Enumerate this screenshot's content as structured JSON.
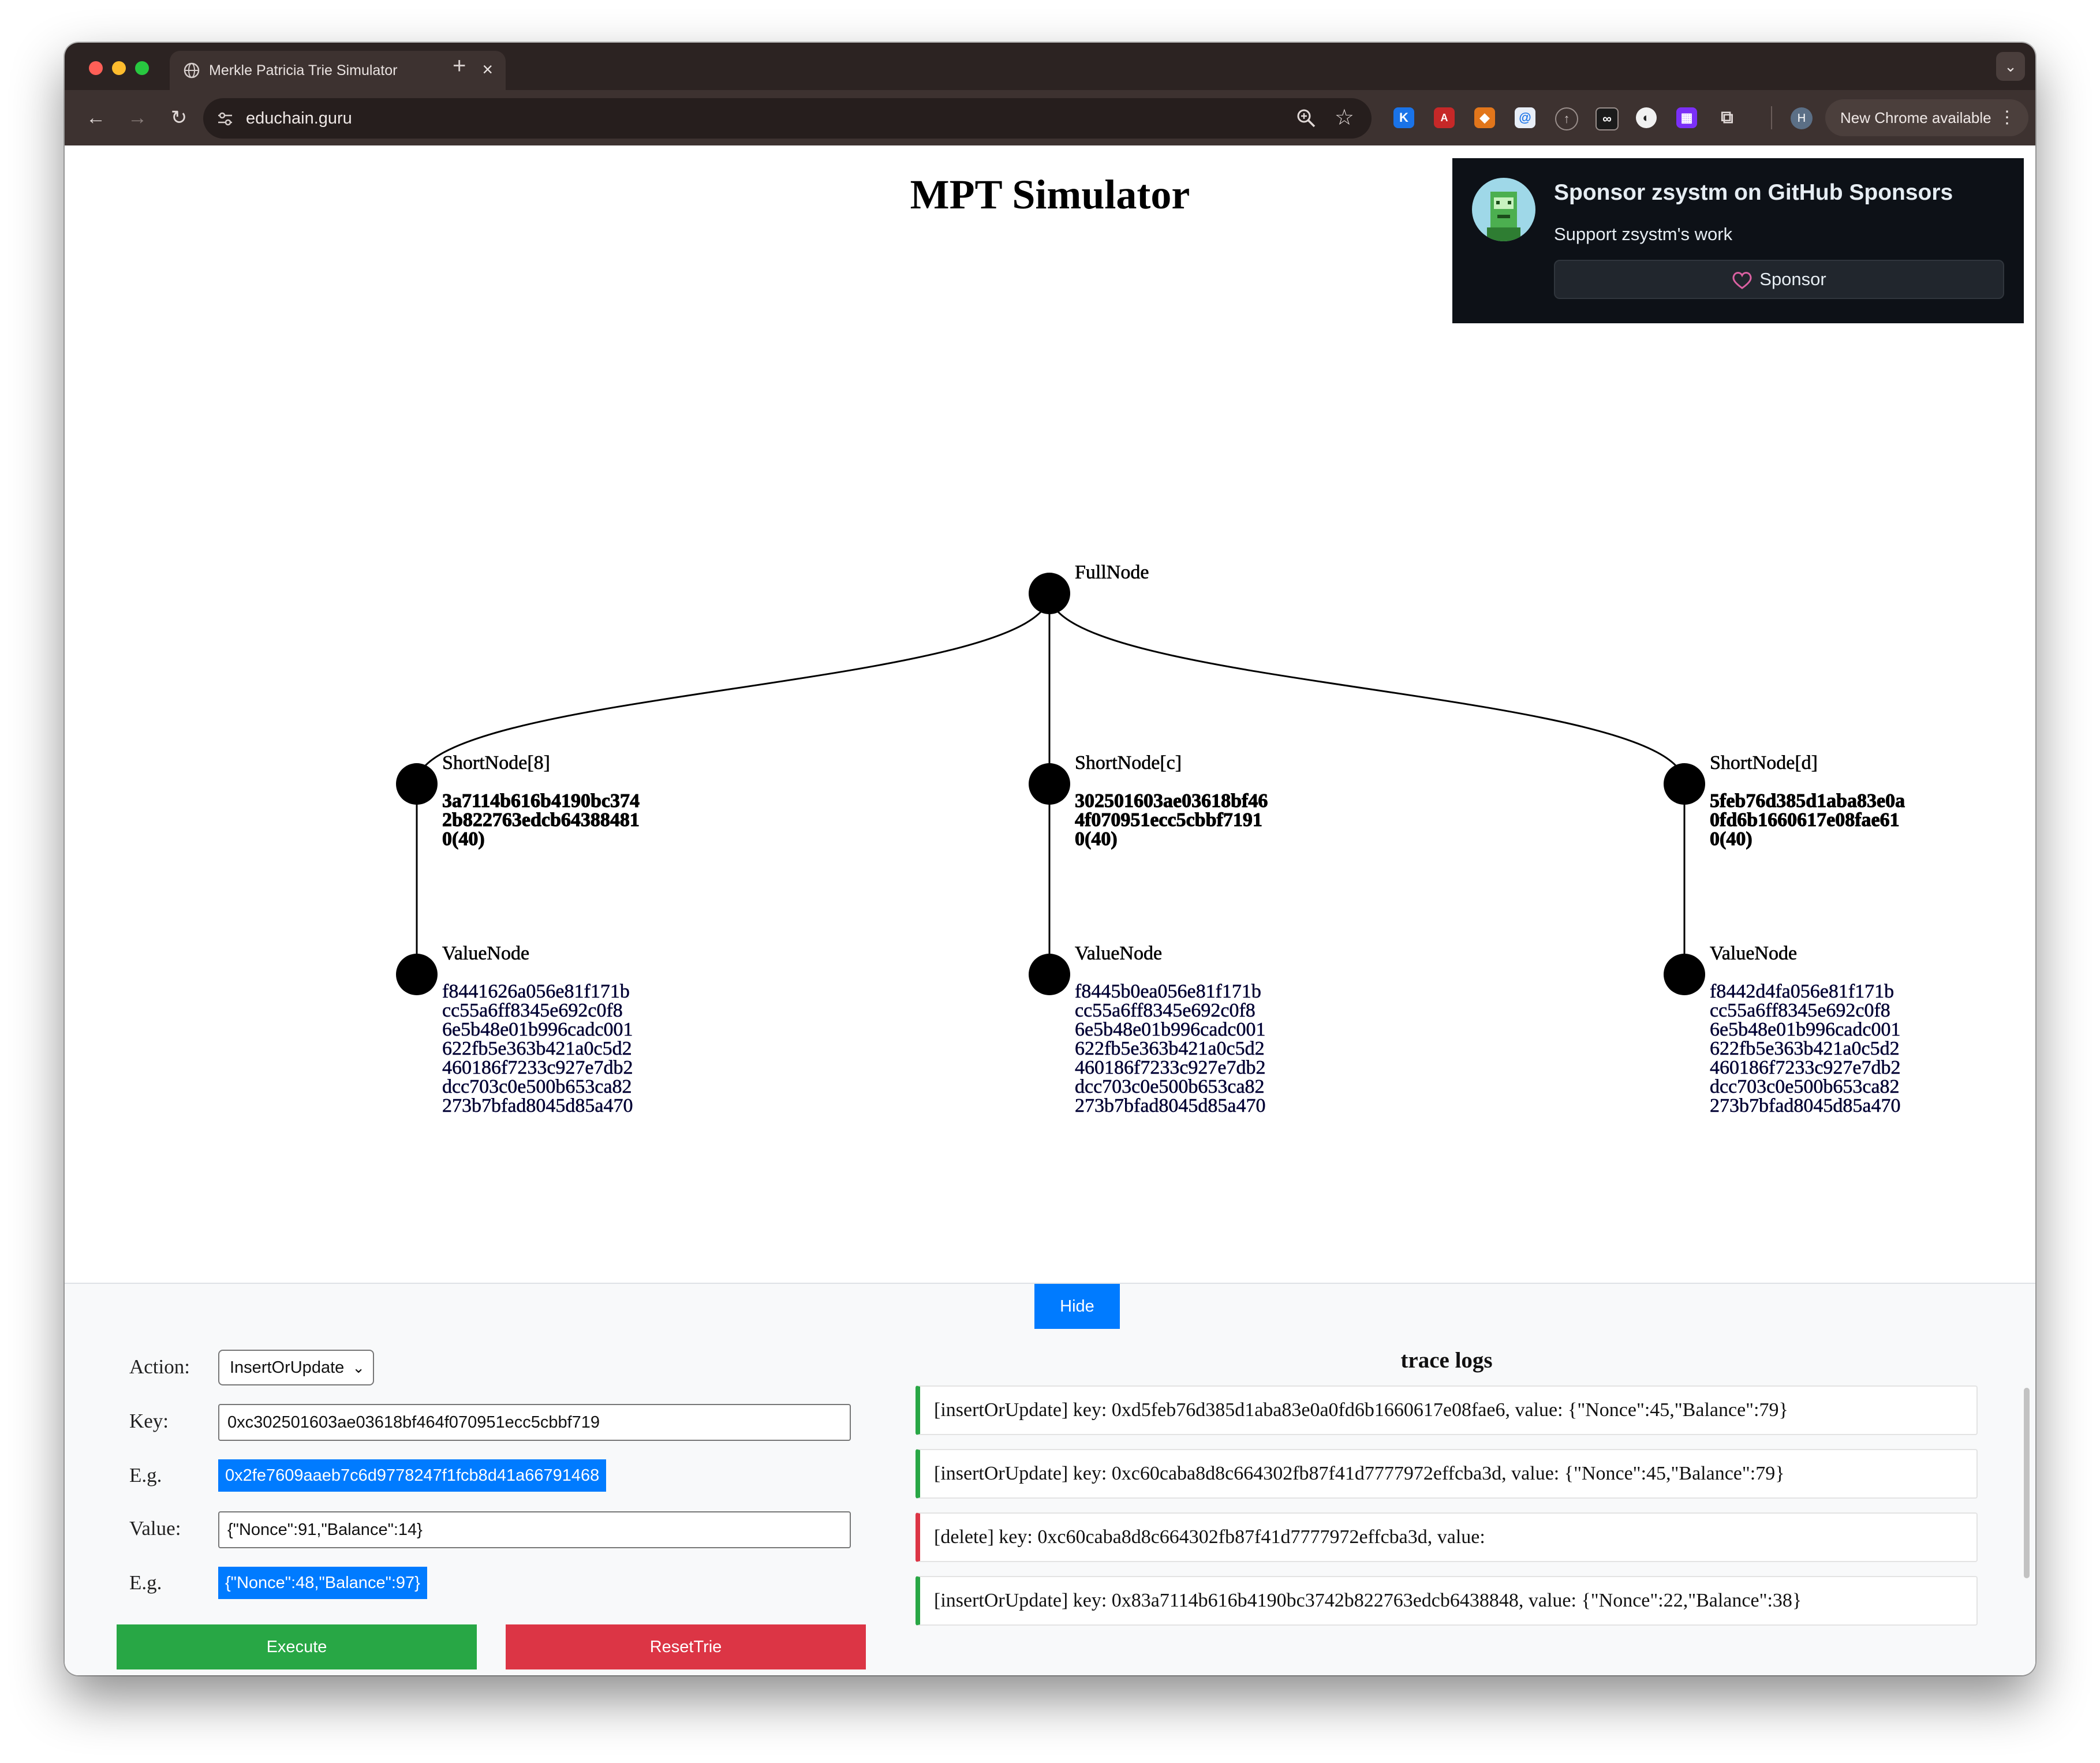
{
  "browser": {
    "tab_title": "Merkle Patricia Trie Simulator",
    "url": "educhain.guru",
    "update_label": "New Chrome available",
    "profile_initial": "H"
  },
  "page": {
    "title": "MPT Simulator"
  },
  "sponsor": {
    "title": "Sponsor zsystm on GitHub Sponsors",
    "subtitle": "Support zsystm's work",
    "button": "Sponsor"
  },
  "tree": {
    "root": {
      "label": "FullNode"
    },
    "children": [
      {
        "short_label": "ShortNode[8]",
        "key_lines": [
          "3a7114b616b4190bc374",
          "2b822763edcb64388481",
          "0(40)"
        ],
        "value_label": "ValueNode",
        "value_lines": [
          "f8441626a056e81f171b",
          "cc55a6ff8345e692c0f8",
          "6e5b48e01b996cadc001",
          "622fb5e363b421a0c5d2",
          "460186f7233c927e7db2",
          "dcc703c0e500b653ca82",
          "273b7bfad8045d85a470"
        ]
      },
      {
        "short_label": "ShortNode[c]",
        "key_lines": [
          "302501603ae03618bf46",
          "4f070951ecc5cbbf7191",
          "0(40)"
        ],
        "value_label": "ValueNode",
        "value_lines": [
          "f8445b0ea056e81f171b",
          "cc55a6ff8345e692c0f8",
          "6e5b48e01b996cadc001",
          "622fb5e363b421a0c5d2",
          "460186f7233c927e7db2",
          "dcc703c0e500b653ca82",
          "273b7bfad8045d85a470"
        ]
      },
      {
        "short_label": "ShortNode[d]",
        "key_lines": [
          "5feb76d385d1aba83e0a",
          "0fd6b1660617e08fae61",
          "0(40)"
        ],
        "value_label": "ValueNode",
        "value_lines": [
          "f8442d4fa056e81f171b",
          "cc55a6ff8345e692c0f8",
          "6e5b48e01b996cadc001",
          "622fb5e363b421a0c5d2",
          "460186f7233c927e7db2",
          "dcc703c0e500b653ca82",
          "273b7bfad8045d85a470"
        ]
      }
    ]
  },
  "panel": {
    "hide_label": "Hide",
    "action_label": "Action:",
    "action_value": "InsertOrUpdate",
    "key_label": "Key:",
    "key_value": "0xc302501603ae03618bf464f070951ecc5cbbf719",
    "eg_label": "E.g.",
    "key_example": "0x2fe7609aaeb7c6d9778247f1fcb8d41a66791468",
    "value_label": "Value:",
    "value_value": "{\"Nonce\":91,\"Balance\":14}",
    "value_example": "{\"Nonce\":48,\"Balance\":97}",
    "execute_label": "Execute",
    "reset_label": "ResetTrie",
    "trace_title": "trace logs",
    "logs": [
      {
        "kind": "insert",
        "text": "[insertOrUpdate] key: 0xd5feb76d385d1aba83e0a0fd6b1660617e08fae6, value: {\"Nonce\":45,\"Balance\":79}"
      },
      {
        "kind": "insert",
        "text": "[insertOrUpdate] key: 0xc60caba8d8c664302fb87f41d7777972effcba3d, value: {\"Nonce\":45,\"Balance\":79}"
      },
      {
        "kind": "delete",
        "text": "[delete] key: 0xc60caba8d8c664302fb87f41d7777972effcba3d, value:"
      },
      {
        "kind": "insert",
        "text": "[insertOrUpdate] key: 0x83a7114b616b4190bc3742b822763edcb6438848, value: {\"Nonce\":22,\"Balance\":38}"
      }
    ]
  }
}
